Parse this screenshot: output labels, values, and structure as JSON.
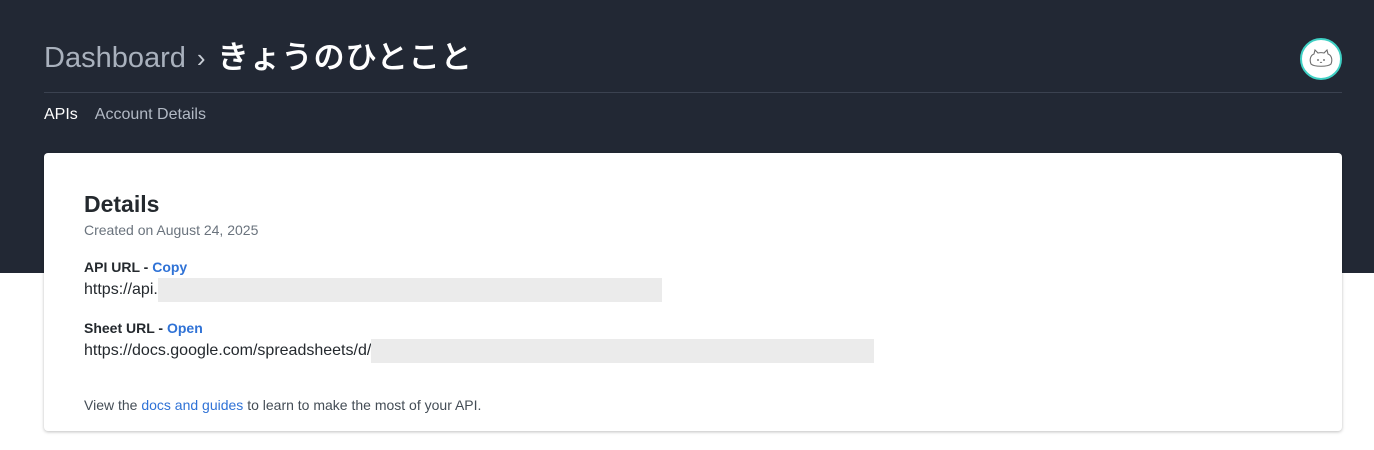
{
  "header": {
    "breadcrumb_root": "Dashboard",
    "breadcrumb_separator": "›",
    "app_name": "きょうのひとこと"
  },
  "avatar": {
    "icon": "cat-face-icon"
  },
  "tabs": [
    {
      "label": "APIs",
      "active": true
    },
    {
      "label": "Account Details",
      "active": false
    }
  ],
  "details": {
    "title": "Details",
    "created": "Created on August 24, 2025",
    "api_url": {
      "label": "API URL - ",
      "action": "Copy",
      "value": "https://api."
    },
    "sheet_url": {
      "label": "Sheet URL - ",
      "action": "Open",
      "value": "https://docs.google.com/spreadsheets/d/"
    },
    "footer": {
      "prefix": "View the ",
      "link": "docs and guides",
      "suffix": " to learn to make the most of your API."
    }
  },
  "colors": {
    "header_bg": "#222834",
    "link": "#2f72d6",
    "avatar_ring": "#3fd0c4",
    "redaction": "#ebebeb"
  }
}
